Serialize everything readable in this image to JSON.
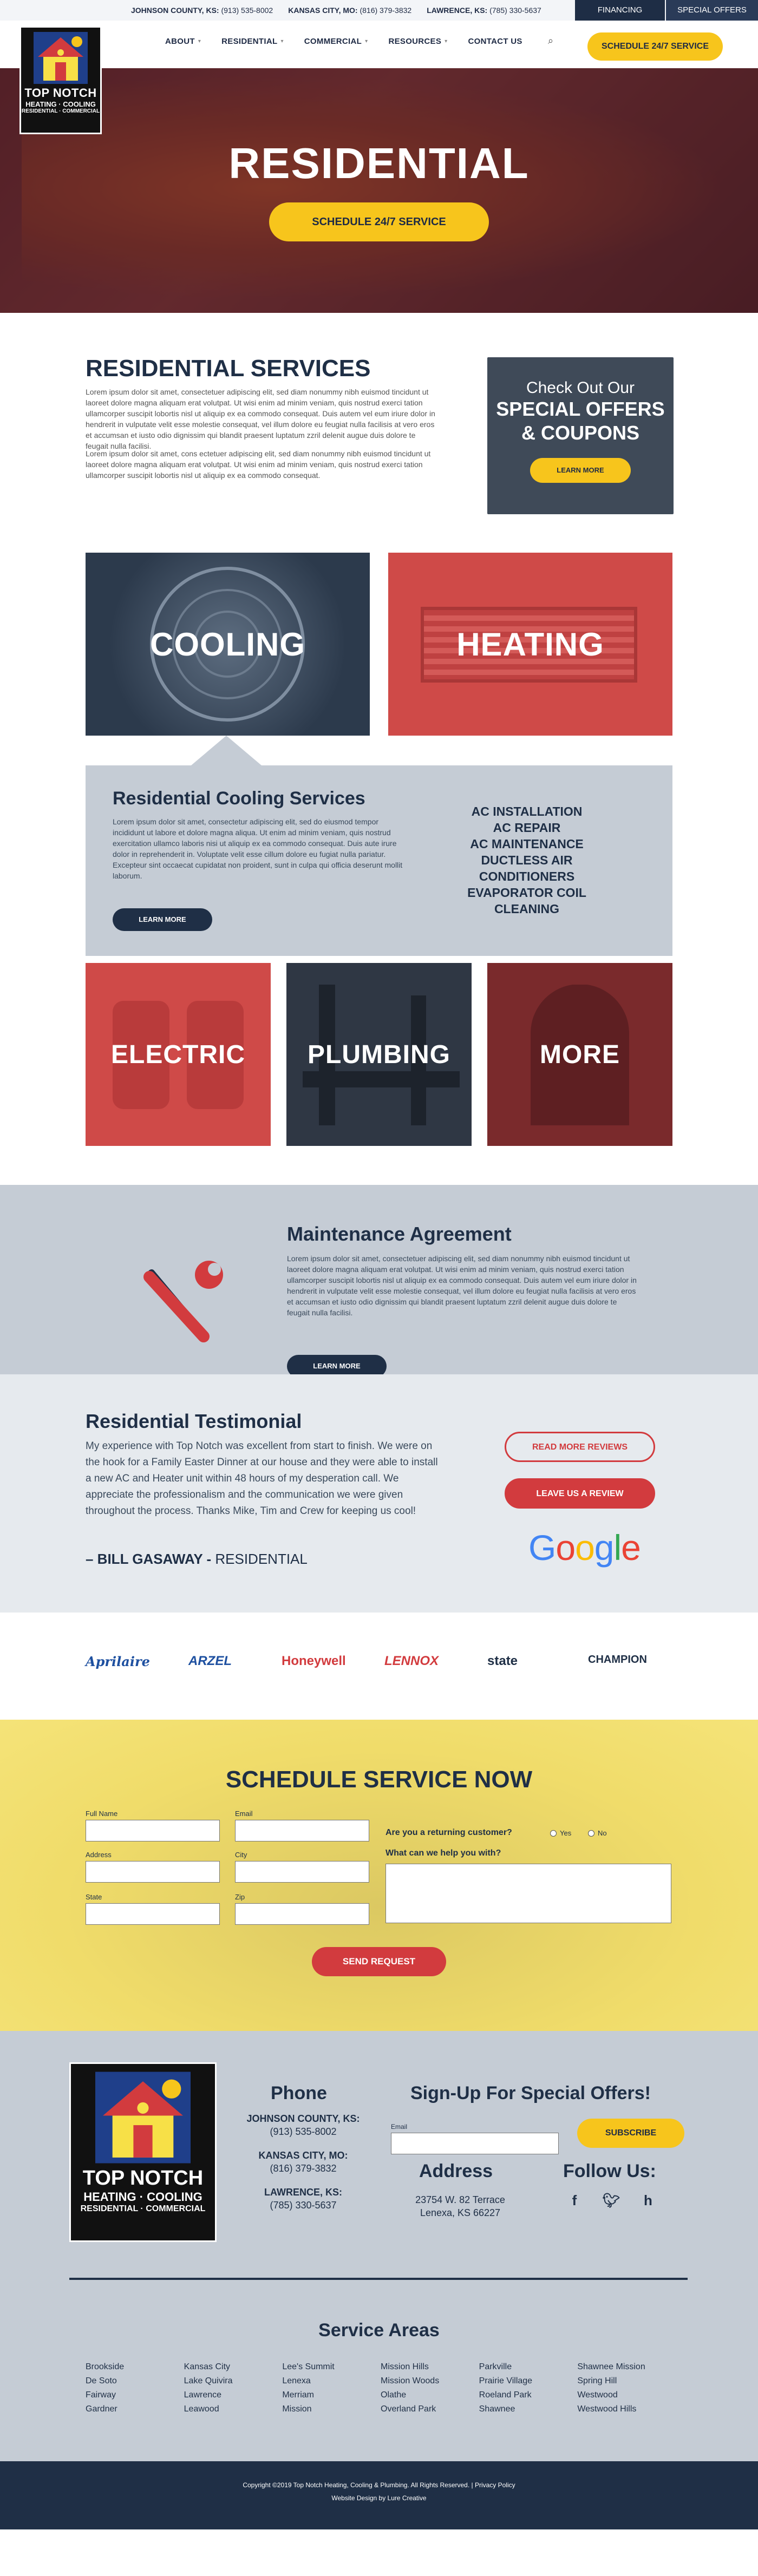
{
  "topbar": {
    "phones": [
      {
        "label": "JOHNSON COUNTY, KS:",
        "number": "(913) 535-8002"
      },
      {
        "label": "KANSAS CITY, MO:",
        "number": "(816) 379-3832"
      },
      {
        "label": "LAWRENCE, KS:",
        "number": "(785) 330-5637"
      }
    ],
    "financing": "FINANCING",
    "special_offers": "SPECIAL OFFERS"
  },
  "logo": {
    "name": "TOP NOTCH",
    "line2": "HEATING · COOLING",
    "line3": "RESIDENTIAL · COMMERCIAL"
  },
  "nav": {
    "items": [
      "ABOUT",
      "RESIDENTIAL",
      "COMMERCIAL",
      "RESOURCES",
      "CONTACT US"
    ],
    "schedule": "SCHEDULE 24/7 SERVICE"
  },
  "hero": {
    "title": "RESIDENTIAL",
    "button": "SCHEDULE 24/7 SERVICE"
  },
  "intro": {
    "title": "RESIDENTIAL SERVICES",
    "p1": "Lorem ipsum dolor sit amet, consectetuer adipiscing elit, sed diam nonummy nibh euismod tincidunt ut laoreet dolore magna aliquam erat volutpat. Ut wisi enim ad minim veniam, quis nostrud exerci tation ullamcorper suscipit lobortis nisl ut aliquip ex ea commodo consequat. Duis autem vel eum iriure dolor in hendrerit in vulputate velit esse molestie consequat, vel illum dolore eu feugiat nulla facilisis at vero eros et accumsan et iusto odio dignissim qui blandit praesent luptatum zzril delenit augue duis dolore te feugait nulla facilisi.",
    "p2": "Lorem ipsum dolor sit amet, cons ectetuer adipiscing elit, sed diam nonummy nibh euismod tincidunt ut laoreet dolore magna aliquam erat volutpat. Ut wisi enim ad minim veniam, quis nostrud exerci tation ullamcorper suscipit lobortis nisl ut aliquip ex ea commodo consequat.",
    "offer_l1": "Check Out Our",
    "offer_l2": "SPECIAL OFFERS",
    "offer_l3": "& COUPONS",
    "offer_btn": "LEARN MORE"
  },
  "tiles": {
    "cooling": "COOLING",
    "heating": "HEATING",
    "electric": "ELECTRIC",
    "plumbing": "PLUMBING",
    "more": "MORE"
  },
  "cooling_services": {
    "title": "Residential Cooling Services",
    "text": "Lorem ipsum dolor sit amet, consectetur adipiscing elit, sed do eiusmod tempor incididunt ut labore et dolore magna aliqua. Ut enim ad minim veniam, quis nostrud exercitation ullamco laboris nisi ut aliquip ex ea commodo consequat. Duis aute irure dolor in reprehenderit in. Voluptate velit esse cillum dolore eu fugiat nulla pariatur. Excepteur sint occaecat cupidatat non proident, sunt in culpa qui officia deserunt mollit laborum.",
    "button": "LEARN MORE",
    "list": [
      "AC INSTALLATION",
      "AC REPAIR",
      "AC MAINTENANCE",
      "DUCTLESS AIR CONDITIONERS",
      "EVAPORATOR COIL CLEANING"
    ]
  },
  "maintenance": {
    "title": "Maintenance Agreement",
    "text": "Lorem ipsum dolor sit amet, consectetuer adipiscing elit, sed diam nonummy nibh euismod tincidunt ut laoreet dolore magna aliquam erat volutpat. Ut wisi enim ad minim veniam, quis nostrud exerci tation ullamcorper suscipit lobortis nisl ut aliquip ex ea commodo consequat. Duis autem vel eum iriure dolor in hendrerit in vulputate velit esse molestie consequat, vel illum dolore eu feugiat nulla facilisis at vero eros et accumsan et iusto odio dignissim qui blandit praesent luptatum zzril delenit augue duis dolore te feugait nulla facilisi.",
    "button": "LEARN MORE"
  },
  "testimonial": {
    "title": "Residential Testimonial",
    "text": "My experience with Top Notch was excellent from start to finish. We were on the hook for a Family Easter Dinner at our house and they were able to install a new AC and Heater unit within 48 hours of my desperation call. We appreciate the professionalism and the communication we were given throughout the process. Thanks Mike, Tim and Crew for keeping us cool!",
    "author": "– BILL GASAWAY -",
    "type": "RESIDENTIAL",
    "read_more": "READ MORE REVIEWS",
    "leave_review": "LEAVE US A REVIEW",
    "google": "Google"
  },
  "brands": [
    "Aprilaire",
    "ARZEL",
    "Honeywell",
    "LENNOX",
    "state",
    "CHAMPION"
  ],
  "schedule": {
    "title": "SCHEDULE SERVICE NOW",
    "full_name": "Full Name",
    "email": "Email",
    "address": "Address",
    "city": "City",
    "state": "State",
    "zip": "Zip",
    "returning": "Are you a returning customer?",
    "yes": "Yes",
    "no": "No",
    "help": "What can we help you with?",
    "send": "SEND REQUEST"
  },
  "footer": {
    "phone_title": "Phone",
    "phones": [
      {
        "label": "JOHNSON COUNTY, KS:",
        "number": "(913) 535-8002"
      },
      {
        "label": "KANSAS CITY, MO:",
        "number": "(816) 379-3832"
      },
      {
        "label": "LAWRENCE, KS:",
        "number": "(785) 330-5637"
      }
    ],
    "signup_title": "Sign-Up For Special Offers!",
    "email_label": "Email",
    "subscribe": "SUBSCRIBE",
    "address_title": "Address",
    "address_l1": "23754 W. 82 Terrace",
    "address_l2": "Lenexa, KS 66227",
    "follow_title": "Follow Us:",
    "service_areas_title": "Service Areas",
    "areas": [
      "Brookside",
      "Kansas City",
      "Lee's Summit",
      "Mission Hills",
      "Parkville",
      "Shawnee Mission",
      "De Soto",
      "Lake Quivira",
      "Lenexa",
      "Mission Woods",
      "Prairie Village",
      "Spring Hill",
      "Fairway",
      "Lawrence",
      "Merriam",
      "Olathe",
      "Roeland Park",
      "Westwood",
      "Gardner",
      "Leawood",
      "Mission",
      "Overland Park",
      "Shawnee",
      "Westwood Hills"
    ],
    "copyright": "Copyright ©2019 Top Notch Heating, Cooling & Plumbing. All Rights Reserved. | Privacy Policy",
    "credit": "Website Design by Lure Creative"
  },
  "colors": {
    "navy": "#1f2f46",
    "yellow": "#f7c51c",
    "red": "#d23b3e",
    "gray": "#c5ccd5"
  }
}
